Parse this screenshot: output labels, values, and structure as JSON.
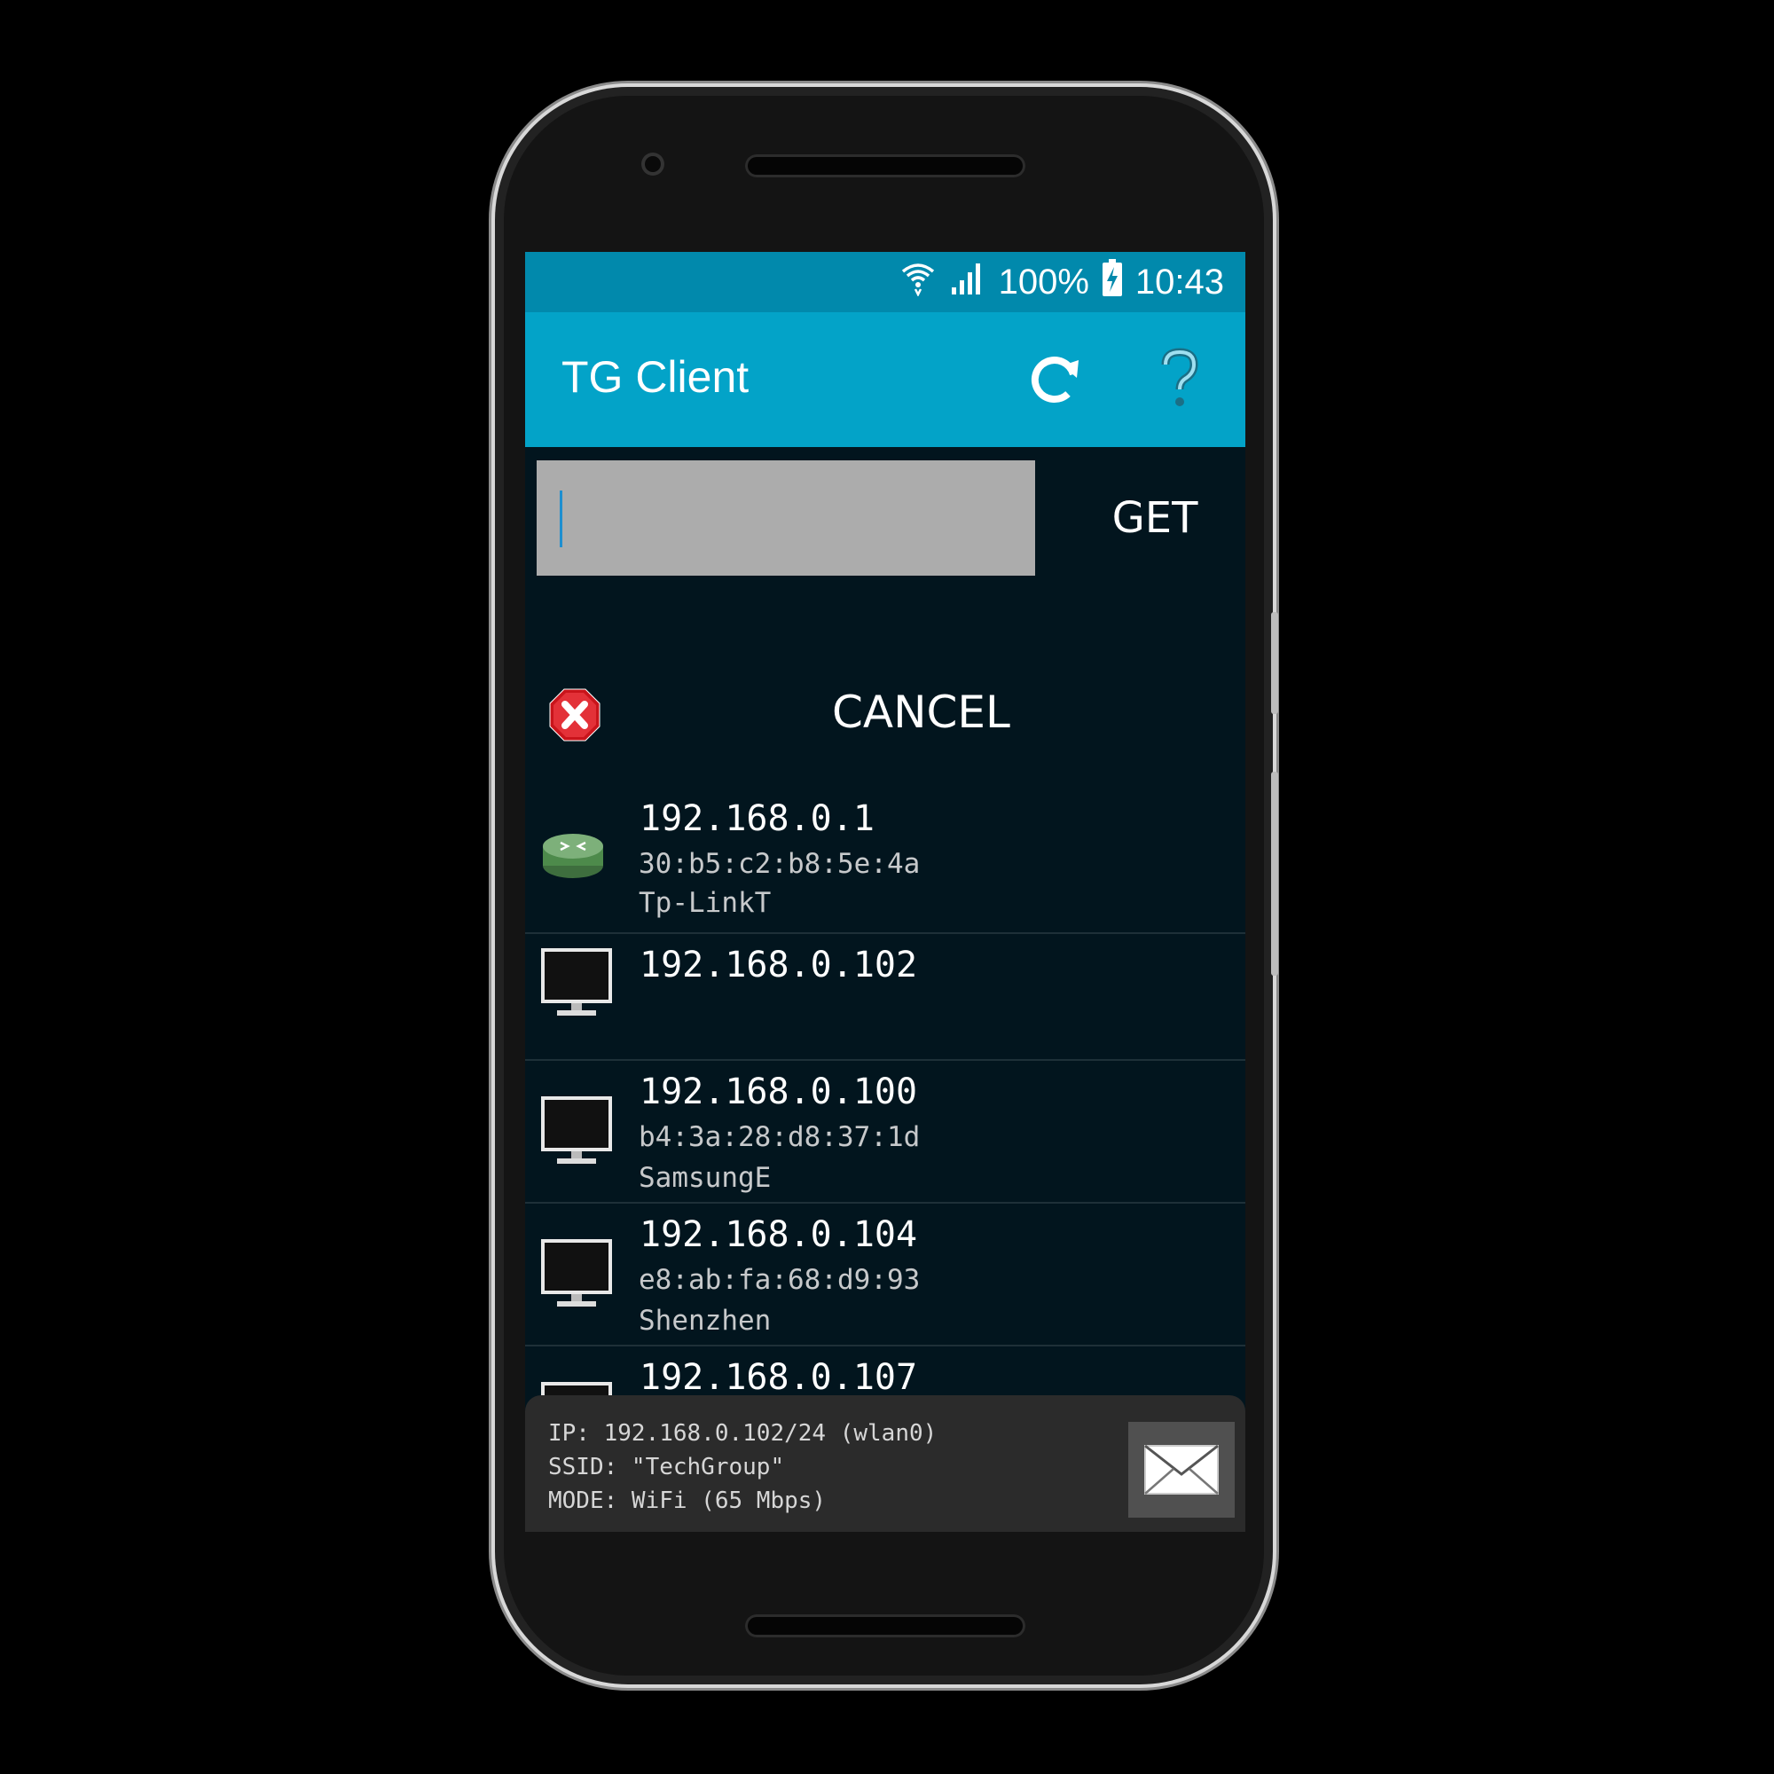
{
  "status_bar": {
    "battery": "100%",
    "time": "10:43",
    "icons": [
      "wifi-icon",
      "cell-signal-icon",
      "battery-charging-icon"
    ]
  },
  "app_bar": {
    "title": "TG Client",
    "actions": [
      "refresh-icon",
      "help-icon"
    ]
  },
  "search": {
    "value": "",
    "get_label": "GET"
  },
  "cancel": {
    "label": "CANCEL",
    "icon": "cancel-stop-icon"
  },
  "devices": [
    {
      "ip": "192.168.0.1",
      "mac": "30:b5:c2:b8:5e:4a",
      "vendor": "Tp-LinkT",
      "icon": "router-icon"
    },
    {
      "ip": "192.168.0.102",
      "mac": "",
      "vendor": "",
      "icon": "monitor-icon"
    },
    {
      "ip": "192.168.0.100",
      "mac": "b4:3a:28:d8:37:1d",
      "vendor": "SamsungE",
      "icon": "monitor-icon"
    },
    {
      "ip": "192.168.0.104",
      "mac": "e8:ab:fa:68:d9:93",
      "vendor": "Shenzhen",
      "icon": "monitor-icon"
    },
    {
      "ip": "192.168.0.107",
      "mac": "",
      "vendor": "",
      "icon": "monitor-icon"
    }
  ],
  "info": {
    "ip_line": "IP: 192.168.0.102/24 (wlan0)",
    "ssid_line": "SSID: \"TechGroup\"",
    "mode_line": "MODE: WiFi (65 Mbps)",
    "mail_icon": "mail-icon"
  },
  "colors": {
    "status_bar": "#0189ac",
    "app_bar": "#03a3c8",
    "background": "#02151e"
  }
}
